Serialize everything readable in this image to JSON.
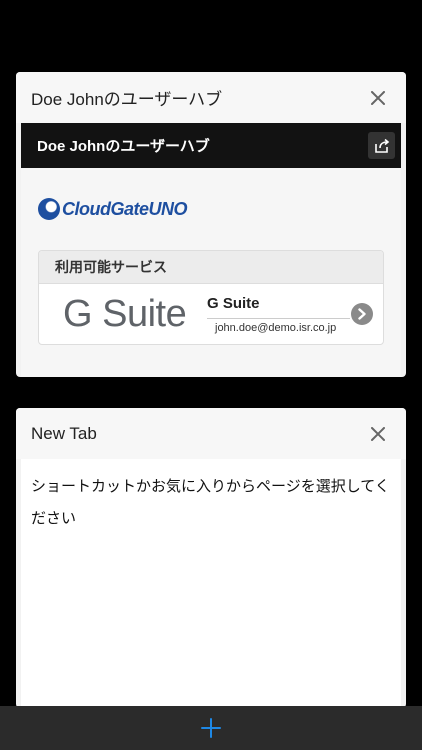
{
  "tabs": [
    {
      "title": "Doe Johnのユーザーハブ",
      "preview": {
        "site_title": "Doe Johnのユーザーハブ",
        "logo_text": "CloudGateUNO",
        "services_header": "利用可能サービス",
        "service": {
          "logo_text": "G Suite",
          "name": "G Suite",
          "email": "john.doe@demo.isr.co.jp"
        }
      }
    },
    {
      "title": "New Tab",
      "preview": {
        "message": "ショートカットかお気に入りからページを選択してください"
      }
    }
  ],
  "colors": {
    "accent": "#1e88e5",
    "site_header_bg": "#121212",
    "logo_blue": "#1e4fa0"
  },
  "icons": {
    "close": "close-icon",
    "share": "share-icon",
    "chevron": "chevron-right-icon",
    "add": "plus-icon"
  }
}
